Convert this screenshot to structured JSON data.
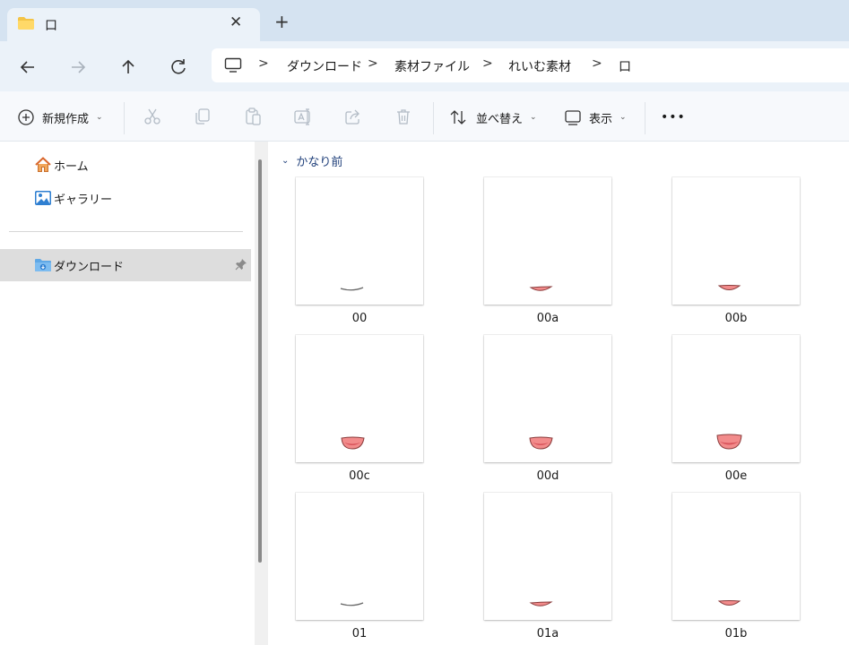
{
  "window": {
    "tab_title": "口",
    "close_label": "✕",
    "new_tab_label": "+"
  },
  "breadcrumb": {
    "separator": ">",
    "items": [
      "ダウンロード",
      "素材ファイル",
      "れいむ素材",
      "口"
    ]
  },
  "toolbar": {
    "new_label": "新規作成",
    "sort_label": "並べ替え",
    "view_label": "表示",
    "more_label": "•••",
    "chevron": "⌄"
  },
  "sidebar": {
    "items": [
      {
        "label": "ホーム",
        "icon": "home-icon"
      },
      {
        "label": "ギャラリー",
        "icon": "gallery-icon"
      },
      {
        "label": "ダウンロード",
        "icon": "downloads-folder-icon",
        "selected": true,
        "pinned": true
      }
    ]
  },
  "content": {
    "group_label": "かなり前",
    "files": [
      {
        "name": "00",
        "mouth": "closed-line"
      },
      {
        "name": "00a",
        "mouth": "thin-open"
      },
      {
        "name": "00b",
        "mouth": "small-open"
      },
      {
        "name": "00c",
        "mouth": "medium-open"
      },
      {
        "name": "00d",
        "mouth": "medium-open"
      },
      {
        "name": "00e",
        "mouth": "wide-open"
      },
      {
        "name": "01",
        "mouth": "closed-line"
      },
      {
        "name": "01a",
        "mouth": "thin-open"
      },
      {
        "name": "01b",
        "mouth": "small-open"
      }
    ]
  },
  "colors": {
    "mouth_fill": "#f28b8b",
    "mouth_inner": "#d9545b",
    "mouth_stroke": "#8a3b3b",
    "line_stroke": "#666666",
    "group_header": "#1f3f7a",
    "tab_bg": "#ebf2f9",
    "titlebar_bg": "#d5e3f1"
  }
}
